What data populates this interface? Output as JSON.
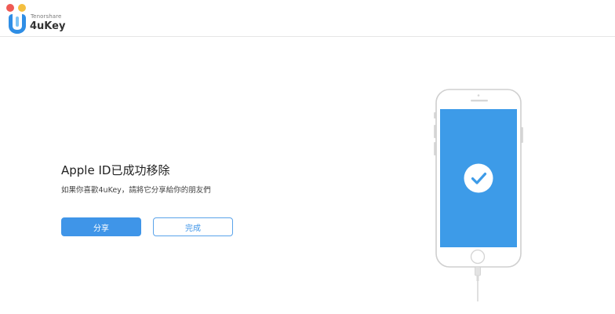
{
  "window": {
    "controls": [
      "close",
      "minimize"
    ]
  },
  "brand": {
    "company": "Tenorshare",
    "product": "4uKey"
  },
  "main": {
    "title": "Apple ID已成功移除",
    "subtitle": "如果你喜歡4uKey，請將它分享給你的朋友們",
    "share_button": "分享",
    "done_button": "完成"
  },
  "colors": {
    "accent": "#3f95e8",
    "screen": "#3d9be8",
    "logo_blue": "#2f8ee5"
  },
  "icons": {
    "logo": "tenorshare-4ukey-logo-icon",
    "phone": "iphone-illustration-icon",
    "success": "checkmark-circle-icon"
  }
}
